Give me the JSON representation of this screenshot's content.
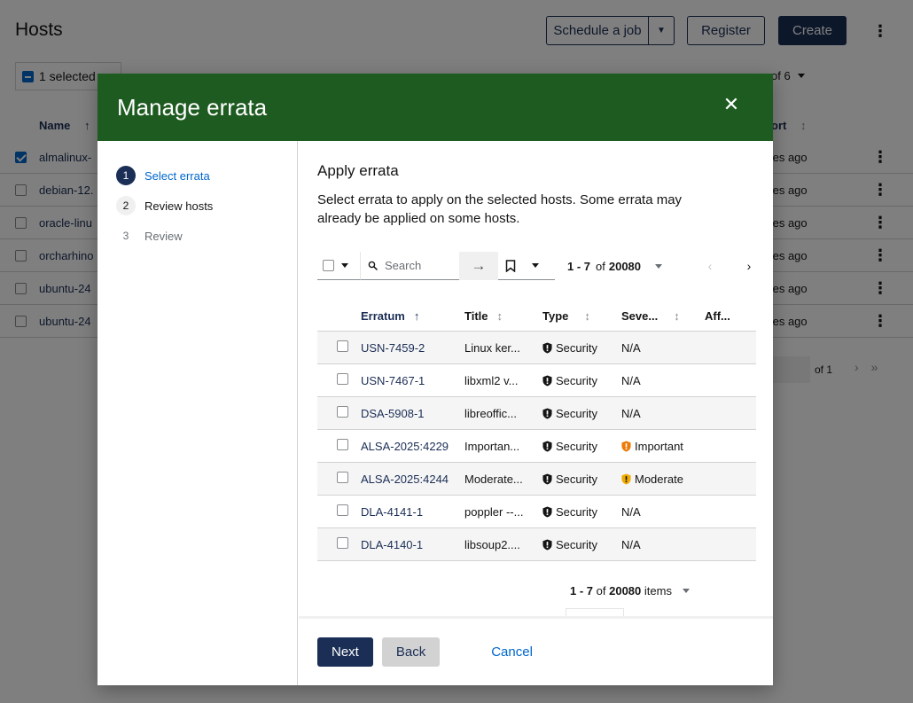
{
  "background": {
    "title": "Hosts",
    "schedule_label": "Schedule a job",
    "register_label": "Register",
    "create_label": "Create",
    "selected_label": "1 selected",
    "name_header": "Name",
    "report_header": "ort",
    "pager_top": "of 6",
    "rows": [
      {
        "name": "almalinux-",
        "ago": "tes ago",
        "checked": true
      },
      {
        "name": "debian-12.",
        "ago": "tes ago",
        "checked": false
      },
      {
        "name": "oracle-linu",
        "ago": "tes ago",
        "checked": false
      },
      {
        "name": "orcharhino",
        "ago": "tes ago",
        "checked": false
      },
      {
        "name": "ubuntu-24",
        "ago": "tes ago",
        "checked": false
      },
      {
        "name": "ubuntu-24",
        "ago": "tes ago",
        "checked": false
      }
    ],
    "pager_bottom": "of 1"
  },
  "modal": {
    "title": "Manage errata",
    "steps": [
      {
        "num": "1",
        "label": "Select errata",
        "state": "current"
      },
      {
        "num": "2",
        "label": "Review hosts",
        "state": "normal"
      },
      {
        "num": "3",
        "label": "Review",
        "state": "disabled"
      }
    ],
    "body_title": "Apply errata",
    "body_desc": "Select errata to apply on the selected hosts. Some errata may already be applied on some hosts.",
    "search_placeholder": "Search",
    "pager": {
      "range": "1 - 7",
      "of": "of",
      "total": "20080",
      "items": "items"
    },
    "columns": {
      "erratum": "Erratum",
      "title": "Title",
      "type": "Type",
      "severity": "Seve...",
      "affected": "Aff..."
    },
    "rows": [
      {
        "erratum": "USN-7459-2",
        "title": "Linux ker...",
        "type": "Security",
        "severity": "N/A",
        "sev_level": "none"
      },
      {
        "erratum": "USN-7467-1",
        "title": "libxml2 v...",
        "type": "Security",
        "severity": "N/A",
        "sev_level": "none"
      },
      {
        "erratum": "DSA-5908-1",
        "title": "libreoffic...",
        "type": "Security",
        "severity": "N/A",
        "sev_level": "none"
      },
      {
        "erratum": "ALSA-2025:4229",
        "title": "Importan...",
        "type": "Security",
        "severity": "Important",
        "sev_level": "important"
      },
      {
        "erratum": "ALSA-2025:4244",
        "title": "Moderate...",
        "type": "Security",
        "severity": "Moderate",
        "sev_level": "moderate"
      },
      {
        "erratum": "DLA-4141-1",
        "title": "poppler --...",
        "type": "Security",
        "severity": "N/A",
        "sev_level": "none"
      },
      {
        "erratum": "DLA-4140-1",
        "title": "libsoup2....",
        "type": "Security",
        "severity": "N/A",
        "sev_level": "none"
      }
    ],
    "footer": {
      "next": "Next",
      "back": "Back",
      "cancel": "Cancel"
    }
  },
  "colors": {
    "header_green": "#1e5b20",
    "primary": "#1b2e55",
    "link": "#0066cc",
    "important": "#ec7a08",
    "moderate": "#f0ab00"
  },
  "icons": {
    "close": "close-icon",
    "search": "search-icon",
    "arrow": "arrow-right-icon",
    "bookmark": "bookmark-icon",
    "shield": "shield-icon"
  }
}
